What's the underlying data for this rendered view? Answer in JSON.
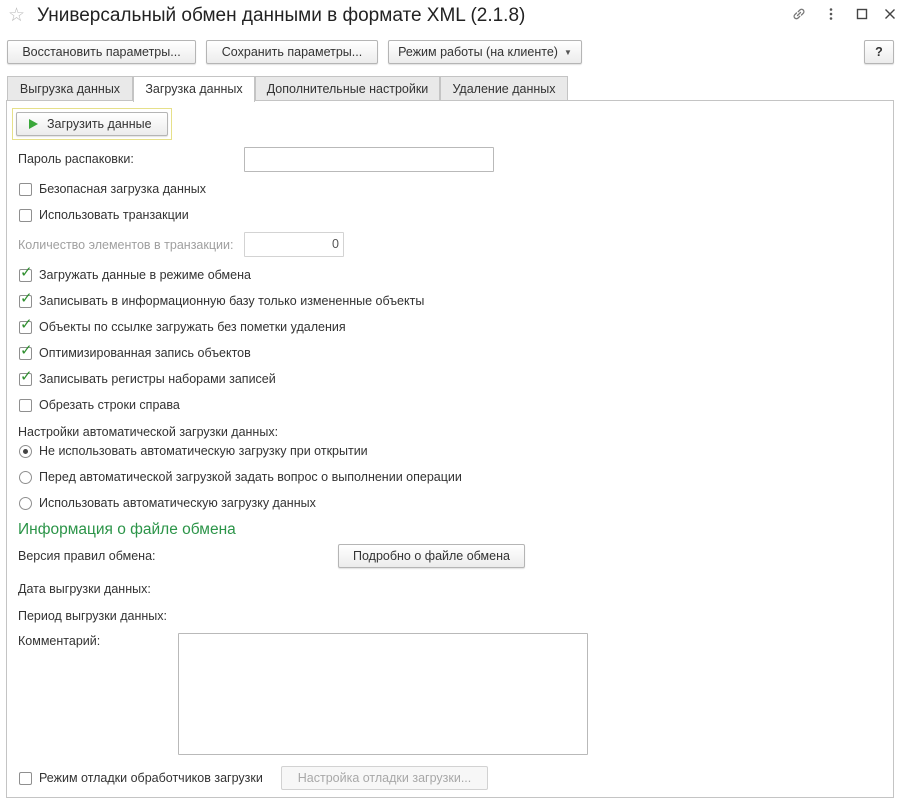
{
  "window": {
    "title": "Универсальный обмен данными в формате XML (2.1.8)",
    "icons": [
      "star-icon",
      "link-icon",
      "more-icon",
      "maximize-icon",
      "close-icon"
    ]
  },
  "toolbar": {
    "restore_label": "Восстановить параметры...",
    "save_label": "Сохранить параметры...",
    "mode_label": "Режим работы (на клиенте)",
    "help_label": "?"
  },
  "tabs": [
    {
      "label": "Выгрузка данных",
      "active": false
    },
    {
      "label": "Загрузка данных",
      "active": true
    },
    {
      "label": "Дополнительные настройки",
      "active": false
    },
    {
      "label": "Удаление данных",
      "active": false
    }
  ],
  "load": {
    "load_button": "Загрузить данные",
    "password_label": "Пароль распаковки:",
    "password_value": "",
    "options": [
      {
        "label": "Безопасная загрузка данных",
        "checked": false
      },
      {
        "label": "Использовать транзакции",
        "checked": false
      }
    ],
    "count_label": "Количество элементов в транзакции:",
    "count_value": "0",
    "options2": [
      {
        "label": "Загружать данные в режиме обмена",
        "checked": true
      },
      {
        "label": "Записывать в информационную базу только измененные объекты",
        "checked": true
      },
      {
        "label": "Объекты по ссылке загружать без пометки удаления",
        "checked": true
      },
      {
        "label": "Оптимизированная запись объектов",
        "checked": true
      },
      {
        "label": "Записывать регистры наборами записей",
        "checked": true
      },
      {
        "label": "Обрезать строки справа",
        "checked": false
      }
    ],
    "auto_label": "Настройки автоматической загрузки данных:",
    "auto_options": [
      {
        "label": "Не использовать автоматическую загрузку при открытии",
        "selected": true
      },
      {
        "label": "Перед автоматической загрузкой задать вопрос о выполнении операции",
        "selected": false
      },
      {
        "label": "Использовать автоматическую загрузку данных",
        "selected": false
      }
    ]
  },
  "info": {
    "section_title": "Информация о файле обмена",
    "rules_version_label": "Версия правил обмена:",
    "details_button": "Подробно о файле обмена",
    "export_date_label": "Дата выгрузки данных:",
    "export_period_label": "Период выгрузки данных:",
    "comment_label": "Комментарий:",
    "comment_value": ""
  },
  "debug": {
    "label": "Режим отладки обработчиков загрузки",
    "checked": false,
    "settings_button": "Настройка отладки загрузки..."
  },
  "colors": {
    "section_green": "#2b9448",
    "check_green": "#2f8f2f",
    "highlight_yellow": "#e6e08a"
  }
}
